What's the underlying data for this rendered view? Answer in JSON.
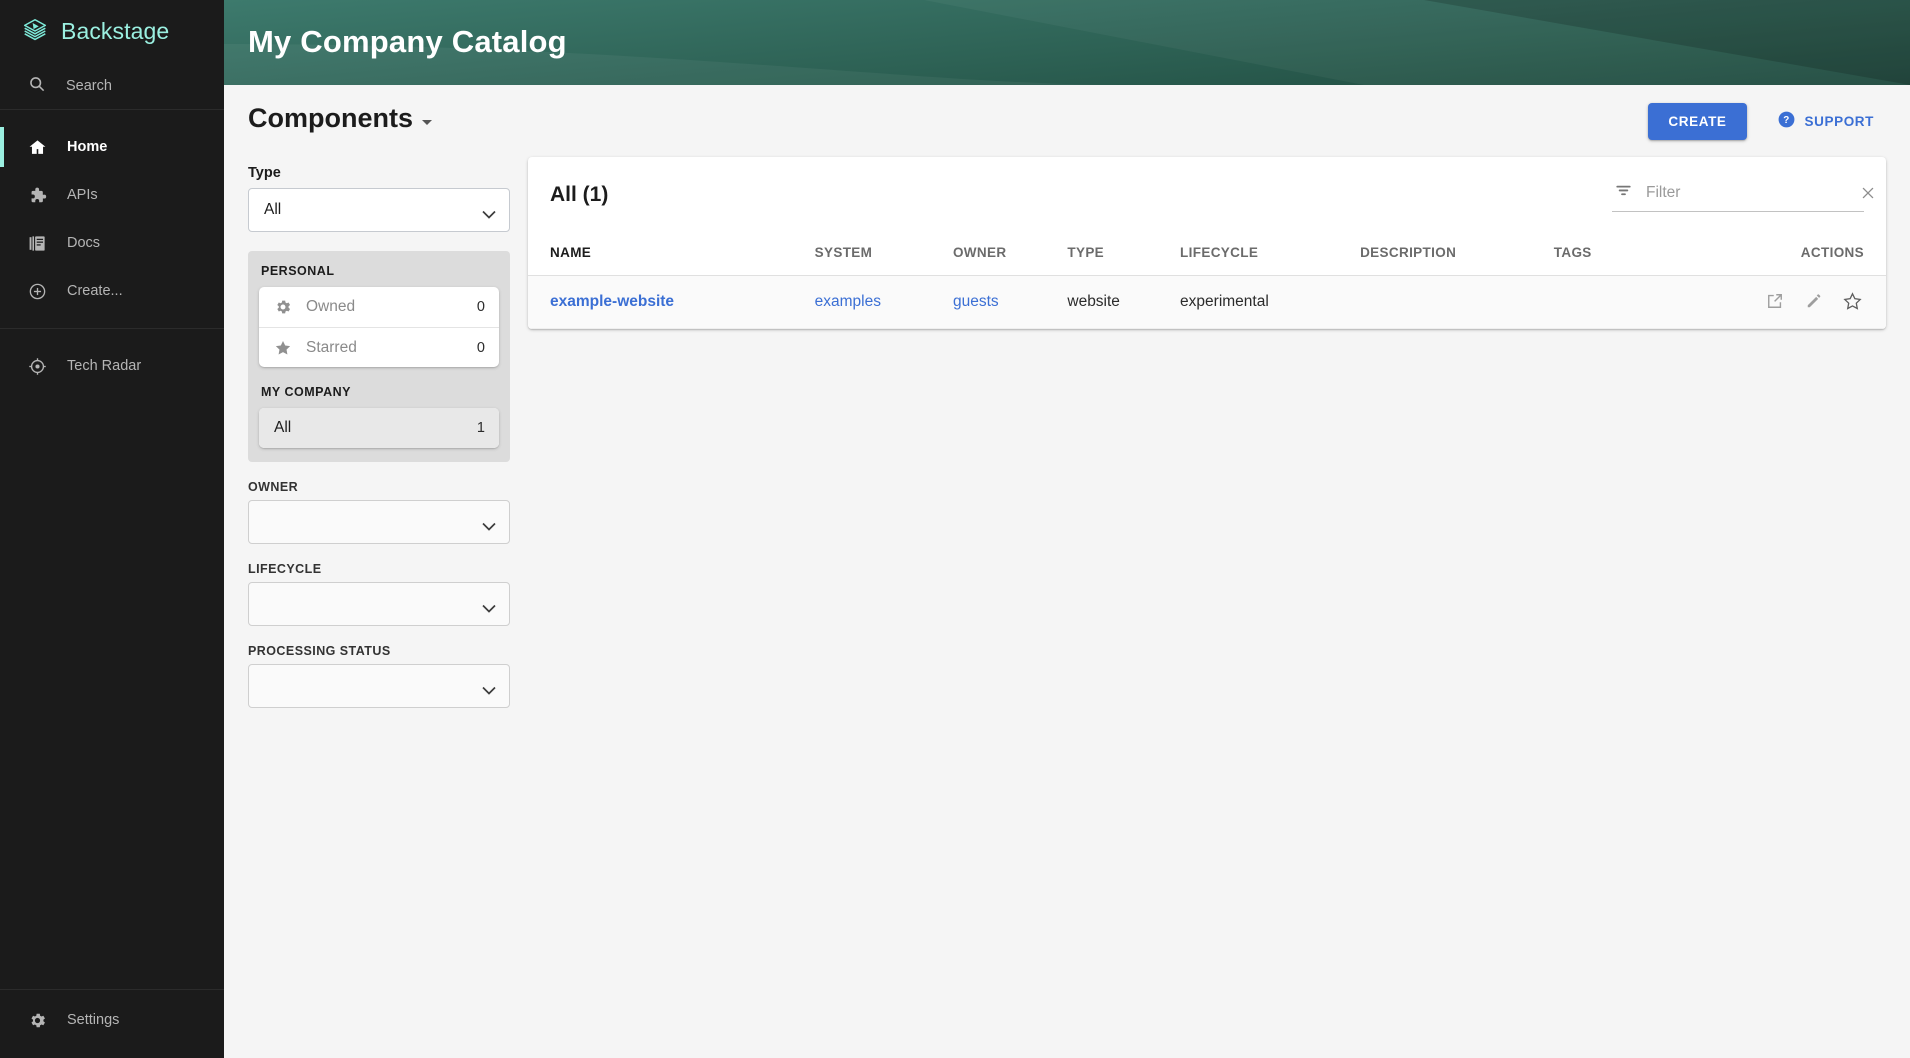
{
  "app": {
    "brand": "Backstage",
    "brand_color": "#9bf0e1",
    "accent_color": "#3b6fd4",
    "header_gradient_from": "#3d7a6d",
    "header_gradient_to": "#1f4a3e"
  },
  "sidebar": {
    "search": {
      "label": "Search",
      "icon": "search-icon"
    },
    "items": [
      {
        "label": "Home",
        "icon": "home-icon",
        "active": true
      },
      {
        "label": "APIs",
        "icon": "extension-puzzle-icon",
        "active": false
      },
      {
        "label": "Docs",
        "icon": "library-books-icon",
        "active": false
      },
      {
        "label": "Create...",
        "icon": "plus-circle-icon",
        "active": false
      }
    ],
    "secondary_items": [
      {
        "label": "Tech Radar",
        "icon": "radar-icon",
        "active": false
      }
    ],
    "bottom_items": [
      {
        "label": "Settings",
        "icon": "gear-icon",
        "active": false
      }
    ]
  },
  "header": {
    "title": "My Company Catalog"
  },
  "page": {
    "title": "Components",
    "create_label": "CREATE",
    "support_label": "SUPPORT"
  },
  "filters": {
    "type": {
      "label": "Type",
      "value": "All"
    },
    "personal": {
      "group_label": "PERSONAL",
      "options": [
        {
          "label": "Owned",
          "count": "0",
          "icon": "gear-icon",
          "selected": false
        },
        {
          "label": "Starred",
          "count": "0",
          "icon": "star-filled-icon",
          "selected": false
        }
      ]
    },
    "my_company": {
      "group_label": "MY COMPANY",
      "options": [
        {
          "label": "All",
          "count": "1",
          "selected": true
        }
      ]
    },
    "owner": {
      "label": "OWNER",
      "value": ""
    },
    "lifecycle": {
      "label": "LIFECYCLE",
      "value": ""
    },
    "processing_status": {
      "label": "PROCESSING STATUS",
      "value": ""
    }
  },
  "table": {
    "title": "All (1)",
    "filter": {
      "placeholder": "Filter",
      "value": "",
      "icon": "filter-list-icon"
    },
    "columns": [
      {
        "label": "NAME",
        "sorted": true
      },
      {
        "label": "SYSTEM",
        "sorted": false
      },
      {
        "label": "OWNER",
        "sorted": false
      },
      {
        "label": "TYPE",
        "sorted": false
      },
      {
        "label": "LIFECYCLE",
        "sorted": false
      },
      {
        "label": "DESCRIPTION",
        "sorted": false
      },
      {
        "label": "TAGS",
        "sorted": false
      },
      {
        "label": "ACTIONS",
        "sorted": false
      }
    ],
    "rows": [
      {
        "name": "example-website",
        "system": "examples",
        "owner": "guests",
        "type": "website",
        "lifecycle": "experimental",
        "description": "",
        "tags": "",
        "actions": [
          "open-in-new-icon",
          "edit-pencil-icon",
          "star-outline-icon"
        ]
      }
    ]
  }
}
